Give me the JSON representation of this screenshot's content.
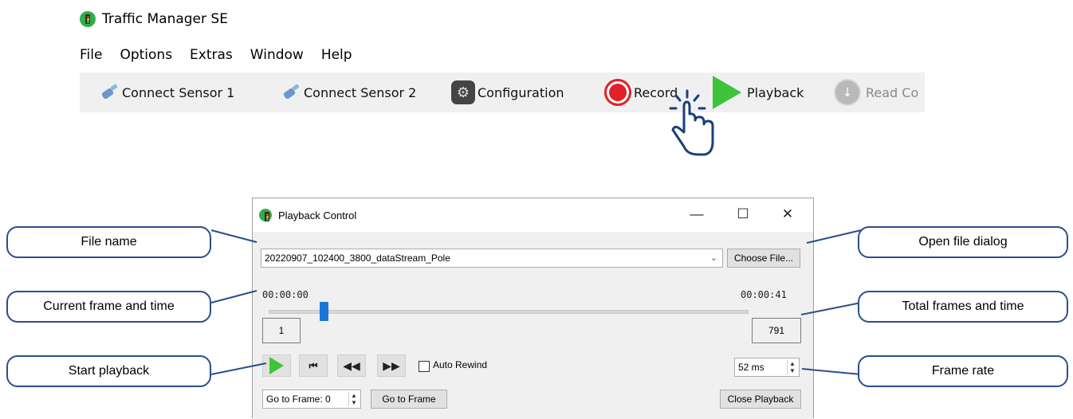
{
  "app": {
    "title": "Traffic Manager SE"
  },
  "menu": [
    "File",
    "Options",
    "Extras",
    "Window",
    "Help"
  ],
  "toolbar": {
    "connect1": "Connect Sensor 1",
    "connect2": "Connect Sensor 2",
    "configuration": "Configuration",
    "record": "Record",
    "playback": "Playback",
    "read": "Read Co"
  },
  "dialog": {
    "title": "Playback Control",
    "file_name": "20220907_102400_3800_dataStream_Pole",
    "choose_file": "Choose File...",
    "start_time": "00:00:00",
    "end_time": "00:00:41",
    "current_frame": "1",
    "total_frames": "791",
    "slider_position": 0.0,
    "auto_rewind_label": "Auto Rewind",
    "auto_rewind_checked": false,
    "frame_rate": "52 ms",
    "goto_frame_value": "Go to Frame: 0",
    "goto_frame_button": "Go to Frame",
    "close_playback": "Close Playback"
  },
  "callouts": {
    "file_name": "File name",
    "current": "Current frame and time",
    "start": "Start playback",
    "open_file": "Open file dialog",
    "total": "Total frames and time",
    "frame_rate": "Frame rate"
  },
  "colors": {
    "callout_border": "#2a4f8f",
    "record_red": "#e2202a",
    "play_green": "#3ec43b",
    "slider_blue": "#1b74d8"
  }
}
